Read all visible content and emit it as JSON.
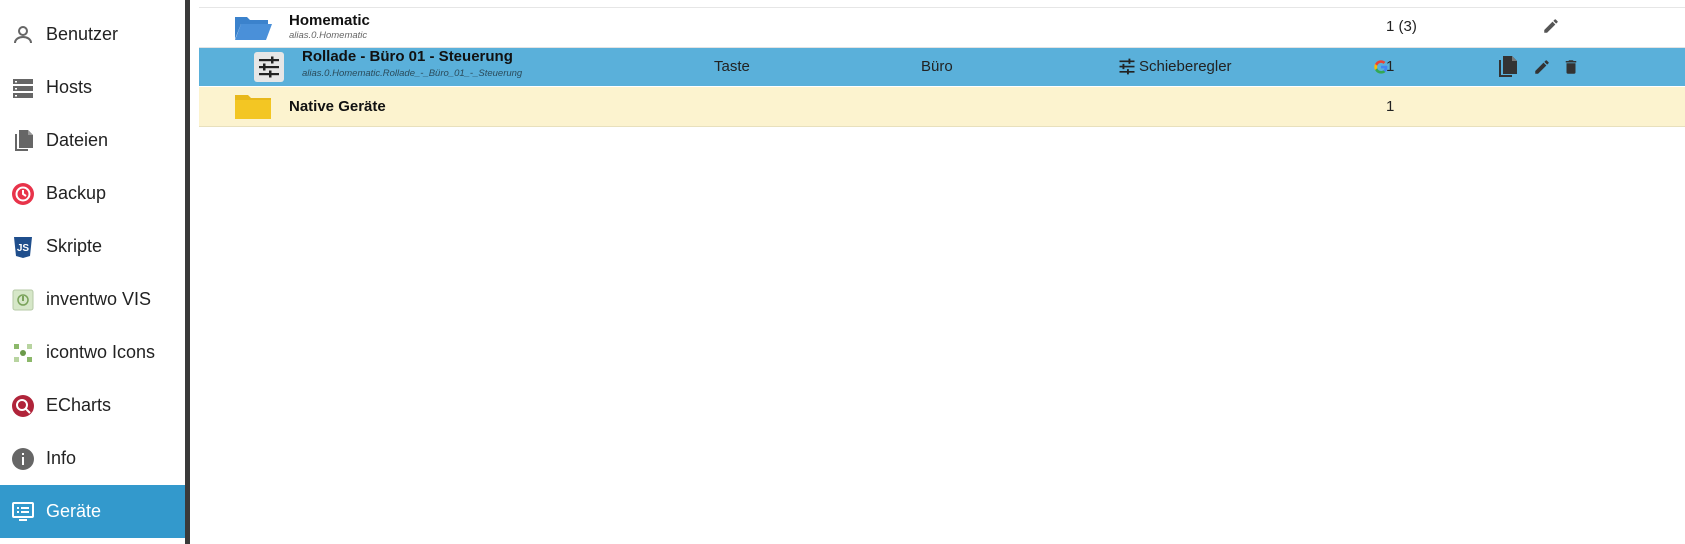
{
  "sidebar": {
    "items": [
      {
        "label": "Benutzer",
        "icon": "user-icon"
      },
      {
        "label": "Hosts",
        "icon": "hosts-icon"
      },
      {
        "label": "Dateien",
        "icon": "files-icon"
      },
      {
        "label": "Backup",
        "icon": "backup-icon"
      },
      {
        "label": "Skripte",
        "icon": "javascript-icon"
      },
      {
        "label": "inventwo VIS",
        "icon": "inventwo-icon"
      },
      {
        "label": "icontwo Icons",
        "icon": "icontwo-icon"
      },
      {
        "label": "ECharts",
        "icon": "echarts-icon"
      },
      {
        "label": "Info",
        "icon": "info-icon"
      },
      {
        "label": "Geräte",
        "icon": "devices-icon",
        "active": true
      }
    ]
  },
  "rows": {
    "homematic": {
      "name": "Homematic",
      "id": "alias.0.Homematic",
      "count": "1 (3)"
    },
    "rollade": {
      "name": "Rollade - Büro 01 - Steuerung",
      "id": "alias.0.Homematic.Rollade_-_Büro_01_-_Steuerung",
      "function": "Taste",
      "room": "Büro",
      "type": "Schieberegler",
      "count": "1"
    },
    "native": {
      "name": "Native Geräte",
      "count": "1"
    }
  },
  "colors": {
    "sidebar_active": "#3399cc",
    "selected_row": "#5ab0da",
    "native_row": "#fcf3cf",
    "folder_blue": "#4a90d9",
    "folder_yellow": "#f3c623"
  }
}
